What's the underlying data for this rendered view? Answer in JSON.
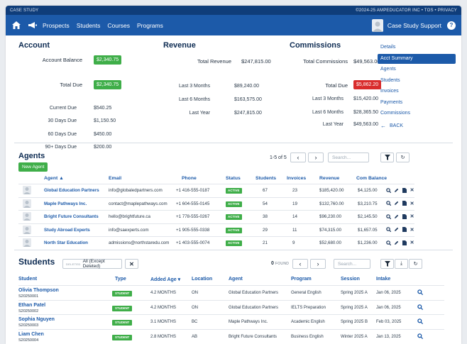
{
  "topbar": {
    "left": "CASE STUDY",
    "right": "©2024-25 AMPEDUCATOR INC • TOS • PRIVACY"
  },
  "nav": {
    "items": [
      "Prospects",
      "Students",
      "Courses",
      "Programs"
    ],
    "user": "Case Study Support",
    "help": "?"
  },
  "account": {
    "title": "Account",
    "balance_label": "Account Balance",
    "balance": "$2,340.75",
    "total_due_label": "Total Due",
    "total_due": "$2,340.75",
    "rows": [
      {
        "label": "Current Due",
        "value": "$540.25"
      },
      {
        "label": "30 Days Due",
        "value": "$1,150.50"
      },
      {
        "label": "60 Days Due",
        "value": "$450.00"
      },
      {
        "label": "90+ Days Due",
        "value": "$200.00"
      }
    ]
  },
  "revenue": {
    "title": "Revenue",
    "total_label": "Total Revenue",
    "total": "$247,815.00",
    "rows": [
      {
        "label": "Last 3 Months",
        "value": "$89,240.00"
      },
      {
        "label": "Last 6 Months",
        "value": "$163,575.00"
      },
      {
        "label": "Last Year",
        "value": "$247,815.00"
      }
    ]
  },
  "commissions": {
    "title": "Commissions",
    "total_label": "Total Commissions",
    "total": "$49,563.00",
    "due_label": "Total Due",
    "due": "$5,862.20",
    "rows": [
      {
        "label": "Last 3 Months",
        "value": "$15,420.00"
      },
      {
        "label": "Last 6 Months",
        "value": "$28,365.50"
      },
      {
        "label": "Last Year",
        "value": "$49,563.00"
      }
    ]
  },
  "sidemenu": {
    "items": [
      "Details",
      "Acct Summary",
      "Agents",
      "Students",
      "Invoices",
      "Payments",
      "Commissions"
    ],
    "active": "Acct Summary",
    "back": "BACK"
  },
  "agents": {
    "title": "Agents",
    "new_button": "New Agent",
    "count": "1-5 of 5",
    "search_placeholder": "Search...",
    "headers": [
      "Agent ▲",
      "Email",
      "Phone",
      "Status",
      "Students",
      "Invoices",
      "Revenue",
      "Com Balance"
    ],
    "rows": [
      {
        "name": "Global Education Partners",
        "email": "info@globaledpartners.com",
        "phone": "+1 416-555-0187",
        "status": "ACTIVE",
        "students": "67",
        "invoices": "23",
        "revenue": "$185,420.00",
        "balance": "$4,125.00"
      },
      {
        "name": "Maple Pathways Inc.",
        "email": "contact@maplepathways.com",
        "phone": "+1 604-555-0145",
        "status": "ACTIVE",
        "students": "54",
        "invoices": "19",
        "revenue": "$132,760.00",
        "balance": "$3,210.75"
      },
      {
        "name": "Bright Future Consultants",
        "email": "hello@brightfuture.ca",
        "phone": "+1 778-555-0267",
        "status": "ACTIVE",
        "students": "38",
        "invoices": "14",
        "revenue": "$96,230.00",
        "balance": "$2,145.50"
      },
      {
        "name": "Study Abroad Experts",
        "email": "info@saexperts.com",
        "phone": "+1 905-555-0338",
        "status": "ACTIVE",
        "students": "29",
        "invoices": "11",
        "revenue": "$74,315.00",
        "balance": "$1,657.05"
      },
      {
        "name": "North Star Education",
        "email": "admissions@northstaredu.com",
        "phone": "+1 403-555-0074",
        "status": "ACTIVE",
        "students": "21",
        "invoices": "9",
        "revenue": "$52,680.00",
        "balance": "$1,236.00"
      }
    ]
  },
  "students": {
    "title": "Students",
    "filter_tag": "DELETED",
    "filter_value": "All (Except Deleted)",
    "found_count": "0",
    "found_label": "FOUND",
    "search_placeholder": "Search...",
    "headers": [
      "Student",
      "Type",
      "Added Age ▾",
      "Location",
      "Agent",
      "Program",
      "Session",
      "Intake"
    ],
    "rows": [
      {
        "name": "Olivia Thompson",
        "id": "S20250001",
        "type": "STUDENT",
        "age": "4.2 MONTHS",
        "location": "ON",
        "agent": "Global Education Partners",
        "program": "General English",
        "session": "Spring 2025 A",
        "intake": "Jan 06, 2025"
      },
      {
        "name": "Ethan Patel",
        "id": "S20250002",
        "type": "STUDENT",
        "age": "4.2 MONTHS",
        "location": "ON",
        "agent": "Global Education Partners",
        "program": "IELTS Preparation",
        "session": "Spring 2025 A",
        "intake": "Jan 06, 2025"
      },
      {
        "name": "Sophia Nguyen",
        "id": "S20250003",
        "type": "STUDENT",
        "age": "3.1 MONTHS",
        "location": "BC",
        "agent": "Maple Pathways Inc.",
        "program": "Academic English",
        "session": "Spring 2025 B",
        "intake": "Feb 03, 2025"
      },
      {
        "name": "Liam Chen",
        "id": "S20250004",
        "type": "STUDENT",
        "age": "2.8 MONTHS",
        "location": "AB",
        "agent": "Bright Future Consultants",
        "program": "Business English",
        "session": "Winter 2025 A",
        "intake": "Jan 13, 2025"
      }
    ]
  },
  "colors": {
    "nav": "#1c5aa9",
    "topbar": "#0f3d7a",
    "green": "#3fae49",
    "red": "#d92c2c"
  }
}
